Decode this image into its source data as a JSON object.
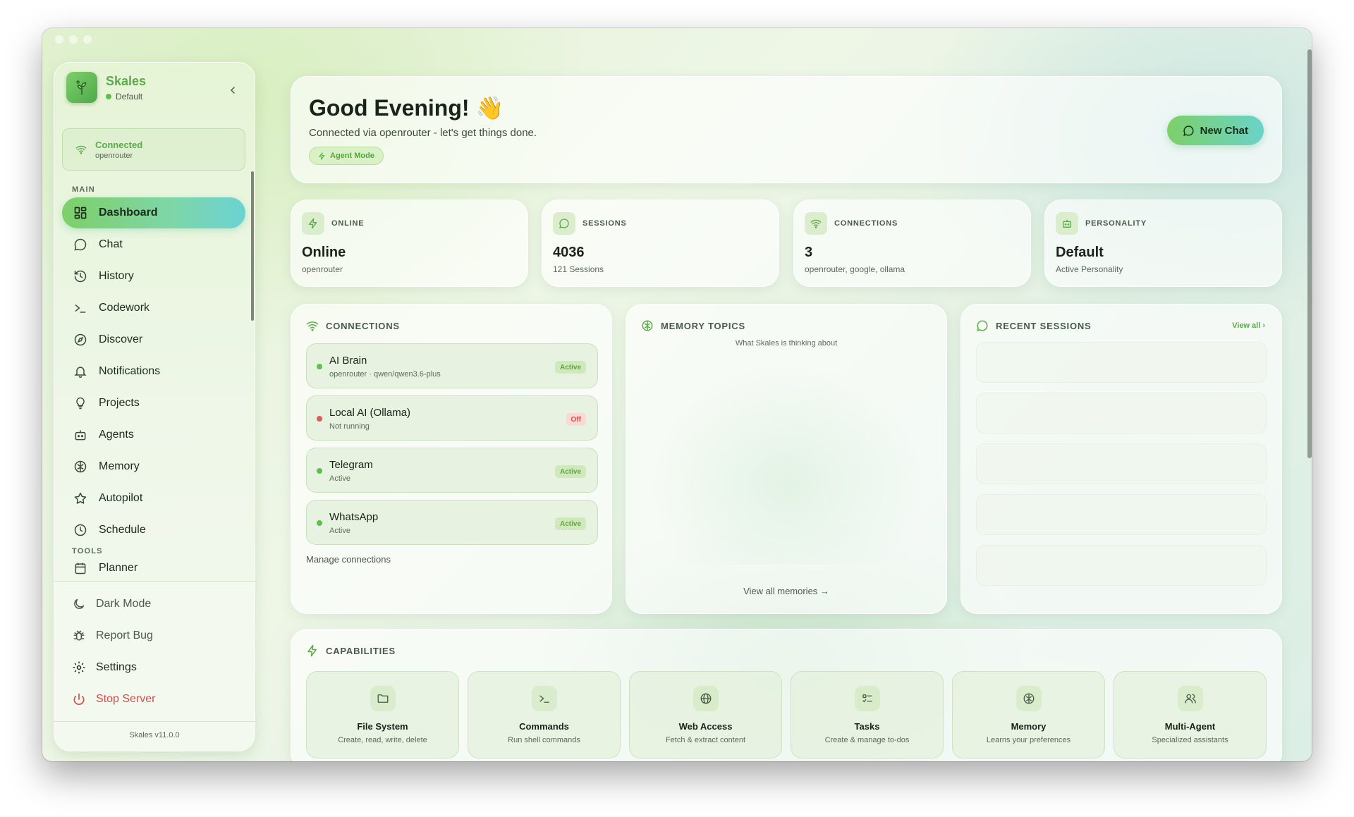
{
  "colors": {
    "accent": "#5caa4a",
    "danger": "#d94b4b",
    "active_gradient_start": "#7dd068",
    "active_gradient_end": "#6ad3d3"
  },
  "sidebar": {
    "brand_name": "Skales",
    "brand_status": "Default",
    "connection": {
      "title": "Connected",
      "provider": "openrouter"
    },
    "main_label": "MAIN",
    "tools_label": "TOOLS",
    "items": [
      {
        "label": "Dashboard",
        "icon": "dashboard-icon",
        "active": true
      },
      {
        "label": "Chat",
        "icon": "chat-icon"
      },
      {
        "label": "History",
        "icon": "history-icon"
      },
      {
        "label": "Codework",
        "icon": "terminal-icon"
      },
      {
        "label": "Discover",
        "icon": "compass-icon"
      },
      {
        "label": "Notifications",
        "icon": "bell-icon"
      },
      {
        "label": "Projects",
        "icon": "lightbulb-icon"
      },
      {
        "label": "Agents",
        "icon": "bot-icon"
      },
      {
        "label": "Memory",
        "icon": "brain-icon"
      },
      {
        "label": "Autopilot",
        "icon": "star-icon"
      },
      {
        "label": "Schedule",
        "icon": "clock-icon"
      }
    ],
    "tools_items": [
      {
        "label": "Planner",
        "icon": "calendar-icon"
      }
    ],
    "footer": {
      "dark_mode": "Dark Mode",
      "report_bug": "Report Bug",
      "settings": "Settings",
      "stop_server": "Stop Server",
      "version": "Skales v11.0.0"
    }
  },
  "header": {
    "greeting": "Good Evening! 👋",
    "subtitle": "Connected via openrouter - let's get things done.",
    "mode_badge": "Agent Mode",
    "new_chat": "New Chat"
  },
  "stats": [
    {
      "label": "ONLINE",
      "value": "Online",
      "sub": "openrouter",
      "icon": "bolt-icon"
    },
    {
      "label": "SESSIONS",
      "value": "4036",
      "sub": "121 Sessions",
      "icon": "chat-icon"
    },
    {
      "label": "CONNECTIONS",
      "value": "3",
      "sub": "openrouter, google, ollama",
      "icon": "wifi-icon"
    },
    {
      "label": "PERSONALITY",
      "value": "Default",
      "sub": "Active Personality",
      "icon": "bot-icon"
    }
  ],
  "connections_panel": {
    "title": "CONNECTIONS",
    "items": [
      {
        "name": "AI Brain",
        "detail": "openrouter · qwen/qwen3.6-plus",
        "status": "Active"
      },
      {
        "name": "Local AI (Ollama)",
        "detail": "Not running",
        "status": "Off"
      },
      {
        "name": "Telegram",
        "detail": "Active",
        "status": "Active"
      },
      {
        "name": "WhatsApp",
        "detail": "Active",
        "status": "Active"
      }
    ],
    "manage": "Manage connections"
  },
  "memory_panel": {
    "title": "MEMORY TOPICS",
    "subtitle": "What Skales is thinking about",
    "link": "View all memories →"
  },
  "sessions_panel": {
    "title": "RECENT SESSIONS",
    "view_all": "View all ›"
  },
  "capabilities": {
    "title": "CAPABILITIES",
    "items": [
      {
        "title": "File System",
        "desc": "Create, read, write, delete",
        "icon": "folder-icon"
      },
      {
        "title": "Commands",
        "desc": "Run shell commands",
        "icon": "terminal-icon"
      },
      {
        "title": "Web Access",
        "desc": "Fetch & extract content",
        "icon": "globe-icon"
      },
      {
        "title": "Tasks",
        "desc": "Create & manage to-dos",
        "icon": "tasks-icon"
      },
      {
        "title": "Memory",
        "desc": "Learns your preferences",
        "icon": "brain-icon"
      },
      {
        "title": "Multi-Agent",
        "desc": "Specialized assistants",
        "icon": "users-icon"
      }
    ]
  }
}
